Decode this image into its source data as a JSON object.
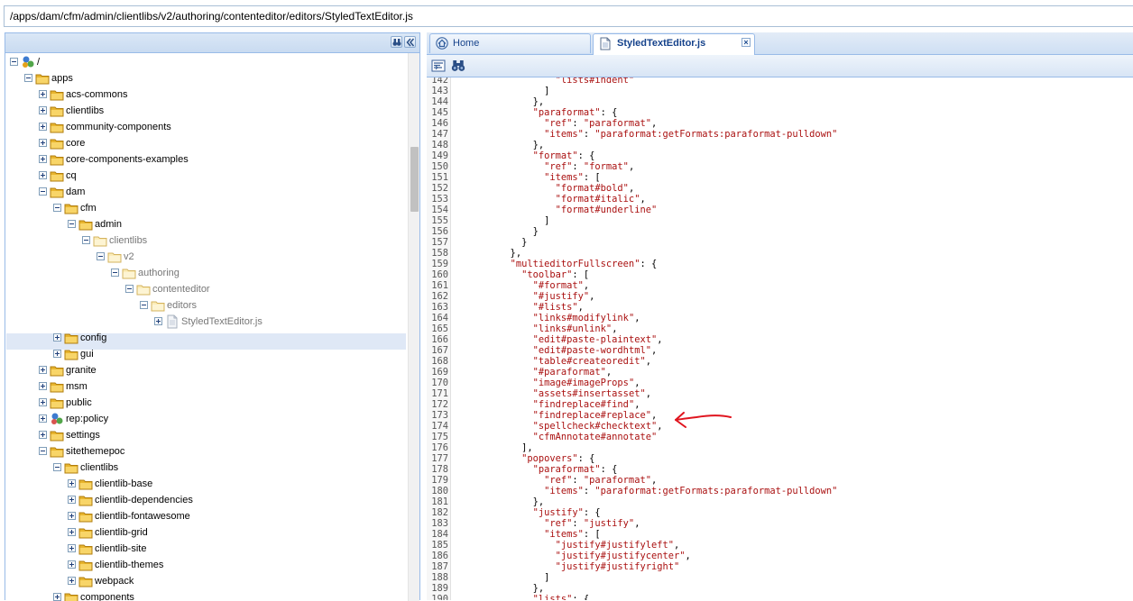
{
  "path_bar": {
    "value": "/apps/dam/cfm/admin/clientlibs/v2/authoring/contenteditor/editors/StyledTextEditor.js"
  },
  "tree": {
    "nodes": [
      {
        "label": "/",
        "depth": 0,
        "toggle": "minus",
        "icon": "root-icon",
        "grey": false
      },
      {
        "label": "apps",
        "depth": 1,
        "toggle": "minus",
        "icon": "folder-icon",
        "grey": false
      },
      {
        "label": "acs-commons",
        "depth": 2,
        "toggle": "plus",
        "icon": "folder-icon",
        "grey": false
      },
      {
        "label": "clientlibs",
        "depth": 2,
        "toggle": "plus",
        "icon": "folder-icon",
        "grey": false
      },
      {
        "label": "community-components",
        "depth": 2,
        "toggle": "plus",
        "icon": "folder-icon",
        "grey": false
      },
      {
        "label": "core",
        "depth": 2,
        "toggle": "plus",
        "icon": "folder-icon",
        "grey": false
      },
      {
        "label": "core-components-examples",
        "depth": 2,
        "toggle": "plus",
        "icon": "folder-icon",
        "grey": false
      },
      {
        "label": "cq",
        "depth": 2,
        "toggle": "plus",
        "icon": "folder-icon",
        "grey": false
      },
      {
        "label": "dam",
        "depth": 2,
        "toggle": "minus",
        "icon": "folder-icon",
        "grey": false
      },
      {
        "label": "cfm",
        "depth": 3,
        "toggle": "minus",
        "icon": "folder-icon",
        "grey": false
      },
      {
        "label": "admin",
        "depth": 4,
        "toggle": "minus",
        "icon": "folder-icon",
        "grey": false
      },
      {
        "label": "clientlibs",
        "depth": 5,
        "toggle": "minus",
        "icon": "folder-open-light-icon",
        "grey": true
      },
      {
        "label": "v2",
        "depth": 6,
        "toggle": "minus",
        "icon": "folder-open-light-icon",
        "grey": true
      },
      {
        "label": "authoring",
        "depth": 7,
        "toggle": "minus",
        "icon": "folder-open-light-icon",
        "grey": true
      },
      {
        "label": "contenteditor",
        "depth": 8,
        "toggle": "minus",
        "icon": "folder-open-light-icon",
        "grey": true
      },
      {
        "label": "editors",
        "depth": 9,
        "toggle": "minus",
        "icon": "folder-open-light-icon",
        "grey": true
      },
      {
        "label": "StyledTextEditor.js",
        "depth": 10,
        "toggle": "plus",
        "icon": "file-icon",
        "grey": true,
        "selected": true
      },
      {
        "label": "config",
        "depth": 3,
        "toggle": "plus",
        "icon": "folder-icon",
        "grey": false
      },
      {
        "label": "gui",
        "depth": 3,
        "toggle": "plus",
        "icon": "folder-icon",
        "grey": false
      },
      {
        "label": "granite",
        "depth": 2,
        "toggle": "plus",
        "icon": "folder-icon",
        "grey": false
      },
      {
        "label": "msm",
        "depth": 2,
        "toggle": "plus",
        "icon": "folder-icon",
        "grey": false
      },
      {
        "label": "public",
        "depth": 2,
        "toggle": "plus",
        "icon": "folder-icon",
        "grey": false
      },
      {
        "label": "rep:policy",
        "depth": 2,
        "toggle": "plus",
        "icon": "policy-icon",
        "grey": false
      },
      {
        "label": "settings",
        "depth": 2,
        "toggle": "plus",
        "icon": "folder-icon",
        "grey": false
      },
      {
        "label": "sitethemepoc",
        "depth": 2,
        "toggle": "minus",
        "icon": "folder-icon",
        "grey": false
      },
      {
        "label": "clientlibs",
        "depth": 3,
        "toggle": "minus",
        "icon": "folder-icon",
        "grey": false
      },
      {
        "label": "clientlib-base",
        "depth": 4,
        "toggle": "plus",
        "icon": "folder-icon",
        "grey": false
      },
      {
        "label": "clientlib-dependencies",
        "depth": 4,
        "toggle": "plus",
        "icon": "folder-icon",
        "grey": false
      },
      {
        "label": "clientlib-fontawesome",
        "depth": 4,
        "toggle": "plus",
        "icon": "folder-icon",
        "grey": false
      },
      {
        "label": "clientlib-grid",
        "depth": 4,
        "toggle": "plus",
        "icon": "folder-icon",
        "grey": false
      },
      {
        "label": "clientlib-site",
        "depth": 4,
        "toggle": "plus",
        "icon": "folder-icon",
        "grey": false
      },
      {
        "label": "clientlib-themes",
        "depth": 4,
        "toggle": "plus",
        "icon": "folder-icon",
        "grey": false
      },
      {
        "label": "webpack",
        "depth": 4,
        "toggle": "plus",
        "icon": "folder-icon",
        "grey": false
      },
      {
        "label": "components",
        "depth": 3,
        "toggle": "plus",
        "icon": "folder-icon",
        "grey": false
      }
    ]
  },
  "tabs": [
    {
      "label": "Home",
      "icon": "home-icon",
      "active": false
    },
    {
      "label": "StyledTextEditor.js",
      "icon": "file-icon",
      "active": true,
      "close": "×"
    }
  ],
  "editor_toolbar": [
    {
      "icon": "format-code-icon"
    },
    {
      "icon": "binoculars-icon"
    }
  ],
  "code_lines": [
    {
      "n": "142",
      "t": "                  \"lists#indent\""
    },
    {
      "n": "143",
      "t": "                ]"
    },
    {
      "n": "144",
      "t": "              },"
    },
    {
      "n": "145",
      "t": "              \"paraformat\": {"
    },
    {
      "n": "146",
      "t": "                \"ref\": \"paraformat\","
    },
    {
      "n": "147",
      "t": "                \"items\": \"paraformat:getFormats:paraformat-pulldown\""
    },
    {
      "n": "148",
      "t": "              },"
    },
    {
      "n": "149",
      "t": "              \"format\": {"
    },
    {
      "n": "150",
      "t": "                \"ref\": \"format\","
    },
    {
      "n": "151",
      "t": "                \"items\": ["
    },
    {
      "n": "152",
      "t": "                  \"format#bold\","
    },
    {
      "n": "153",
      "t": "                  \"format#italic\","
    },
    {
      "n": "154",
      "t": "                  \"format#underline\""
    },
    {
      "n": "155",
      "t": "                ]"
    },
    {
      "n": "156",
      "t": "              }"
    },
    {
      "n": "157",
      "t": "            }"
    },
    {
      "n": "158",
      "t": "          },"
    },
    {
      "n": "159",
      "t": "          \"multieditorFullscreen\": {"
    },
    {
      "n": "160",
      "t": "            \"toolbar\": ["
    },
    {
      "n": "161",
      "t": "              \"#format\","
    },
    {
      "n": "162",
      "t": "              \"#justify\","
    },
    {
      "n": "163",
      "t": "              \"#lists\","
    },
    {
      "n": "164",
      "t": "              \"links#modifylink\","
    },
    {
      "n": "165",
      "t": "              \"links#unlink\","
    },
    {
      "n": "166",
      "t": "              \"edit#paste-plaintext\","
    },
    {
      "n": "167",
      "t": "              \"edit#paste-wordhtml\","
    },
    {
      "n": "168",
      "t": "              \"table#createoredit\","
    },
    {
      "n": "169",
      "t": "              \"#paraformat\","
    },
    {
      "n": "170",
      "t": "              \"image#imageProps\","
    },
    {
      "n": "171",
      "t": "              \"assets#insertasset\","
    },
    {
      "n": "172",
      "t": "              \"findreplace#find\","
    },
    {
      "n": "173",
      "t": "              \"findreplace#replace\","
    },
    {
      "n": "174",
      "t": "              \"spellcheck#checktext\","
    },
    {
      "n": "175",
      "t": "              \"cfmAnnotate#annotate\""
    },
    {
      "n": "176",
      "t": "            ],"
    },
    {
      "n": "177",
      "t": "            \"popovers\": {"
    },
    {
      "n": "178",
      "t": "              \"paraformat\": {"
    },
    {
      "n": "179",
      "t": "                \"ref\": \"paraformat\","
    },
    {
      "n": "180",
      "t": "                \"items\": \"paraformat:getFormats:paraformat-pulldown\""
    },
    {
      "n": "181",
      "t": "              },"
    },
    {
      "n": "182",
      "t": "              \"justify\": {"
    },
    {
      "n": "183",
      "t": "                \"ref\": \"justify\","
    },
    {
      "n": "184",
      "t": "                \"items\": ["
    },
    {
      "n": "185",
      "t": "                  \"justify#justifyleft\","
    },
    {
      "n": "186",
      "t": "                  \"justify#justifycenter\","
    },
    {
      "n": "187",
      "t": "                  \"justify#justifyright\""
    },
    {
      "n": "188",
      "t": "                ]"
    },
    {
      "n": "189",
      "t": "              },"
    },
    {
      "n": "190",
      "t": "              \"lists\": {"
    }
  ],
  "colors": {
    "string": "#aa1111",
    "accent": "#15428b",
    "border": "#99bbe8",
    "annotation": "#e0141e"
  }
}
